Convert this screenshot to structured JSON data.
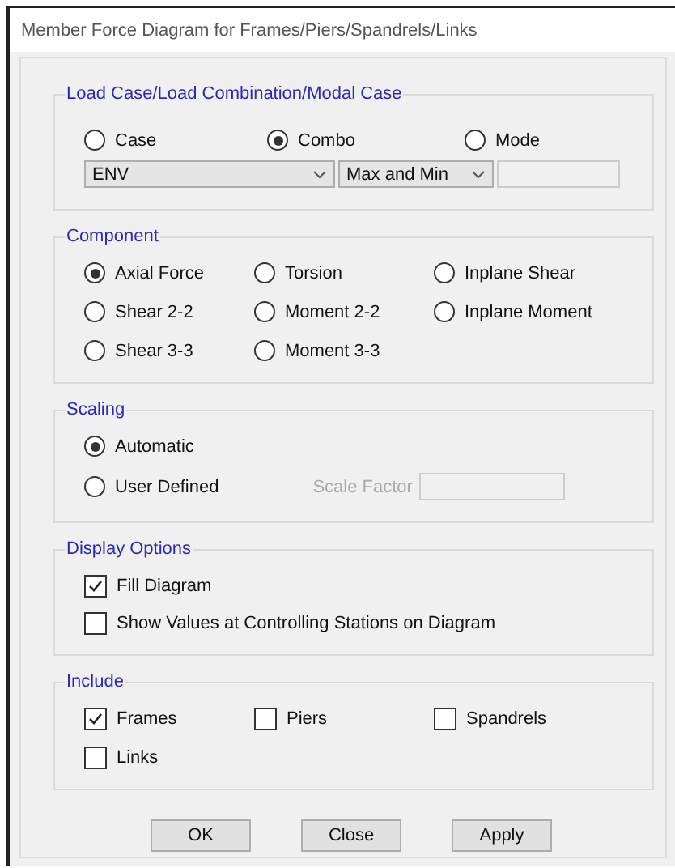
{
  "window": {
    "title": "Member Force Diagram for Frames/Piers/Spandrels/Links"
  },
  "load_case": {
    "title": "Load Case/Load Combination/Modal Case",
    "options": [
      {
        "label": "Case",
        "selected": false
      },
      {
        "label": "Combo",
        "selected": true
      },
      {
        "label": "Mode",
        "selected": false
      }
    ],
    "case_dropdown": {
      "value": "ENV"
    },
    "type_dropdown": {
      "value": "Max and Min"
    },
    "number_field": {
      "disabled": true
    }
  },
  "component": {
    "title": "Component",
    "options": [
      {
        "label": "Axial Force",
        "selected": true
      },
      {
        "label": "Torsion",
        "selected": false
      },
      {
        "label": "Inplane Shear",
        "selected": false
      },
      {
        "label": "Shear 2-2",
        "selected": false
      },
      {
        "label": "Moment 2-2",
        "selected": false
      },
      {
        "label": "Inplane Moment",
        "selected": false
      },
      {
        "label": "Shear 3-3",
        "selected": false
      },
      {
        "label": "Moment 3-3",
        "selected": false
      }
    ]
  },
  "scaling": {
    "title": "Scaling",
    "options": [
      {
        "label": "Automatic",
        "selected": true
      },
      {
        "label": "User Defined",
        "selected": false
      }
    ],
    "scale_factor": {
      "label": "Scale Factor",
      "disabled": true
    }
  },
  "display_options": {
    "title": "Display Options",
    "checkboxes": [
      {
        "label": "Fill Diagram",
        "checked": true
      },
      {
        "label": "Show Values at Controlling Stations on Diagram",
        "checked": false
      }
    ]
  },
  "include": {
    "title": "Include",
    "checkboxes": [
      {
        "label": "Frames",
        "checked": true
      },
      {
        "label": "Piers",
        "checked": false
      },
      {
        "label": "Spandrels",
        "checked": false
      },
      {
        "label": "Links",
        "checked": false
      }
    ]
  },
  "buttons": [
    "OK",
    "Close",
    "Apply"
  ]
}
